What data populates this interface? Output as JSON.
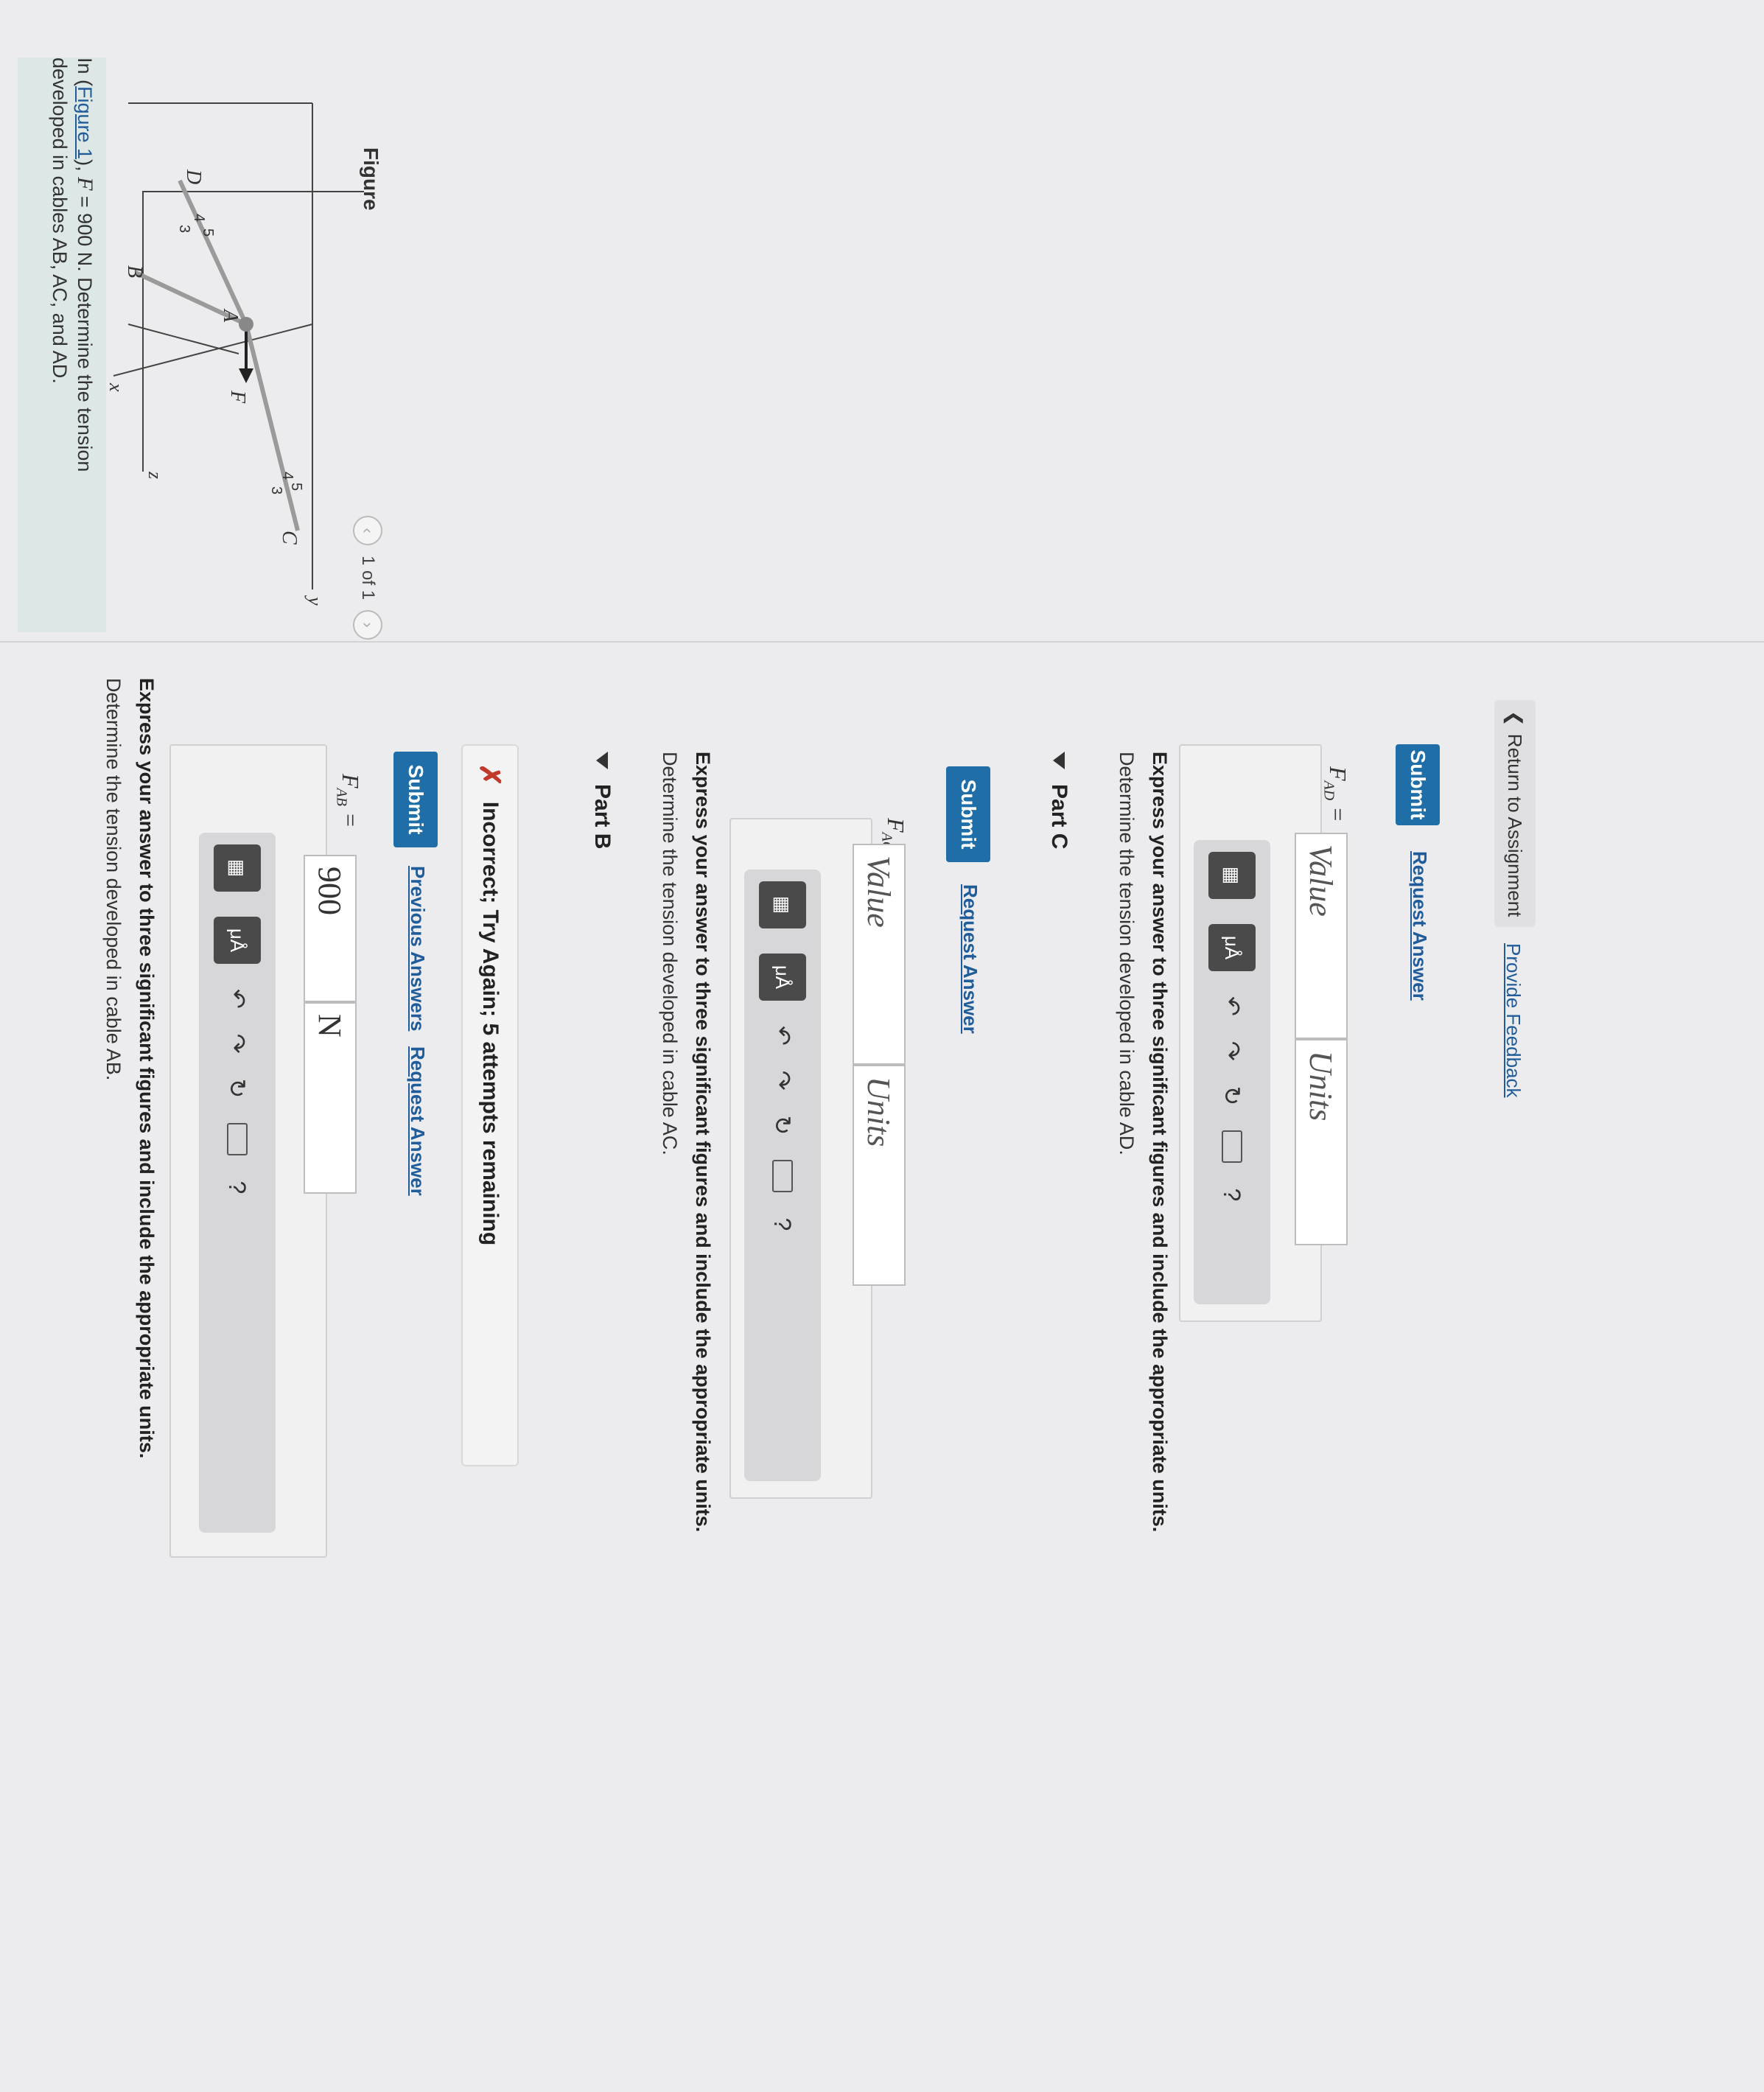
{
  "problem": {
    "prefix": "In (",
    "figure_link": "Figure 1",
    "after_link": "), ",
    "force_var": "F",
    "force_value": " = 900 N. Determine the tension",
    "line2": "developed in cables AB, AC, and AD."
  },
  "figure": {
    "label": "Figure",
    "pager": "1 of 1",
    "prev_icon": "chevron-left",
    "next_icon": "chevron-right",
    "points": {
      "D": "D",
      "B": "B",
      "A": "A",
      "C": "C",
      "F": "F",
      "x": "x",
      "y": "y",
      "z": "z"
    },
    "ratios": {
      "d_4": "4",
      "d_3": "3",
      "d_5": "5",
      "c_4": "4",
      "c_3": "3",
      "c_5": "5"
    }
  },
  "part_a": {
    "prompt": "Determine the tension developed in cable AB.",
    "instruction": "Express your answer to three significant figures and include the appropriate units.",
    "label": "F",
    "label_sub": "AB",
    "equals": " =",
    "value": "900",
    "units": "N",
    "submit": "Submit",
    "previous_answers": "Previous Answers",
    "request_answer": "Request Answer",
    "feedback": "Incorrect; Try Again; 5 attempts remaining"
  },
  "part_b": {
    "title": "Part B",
    "prompt": "Determine the tension developed in cable AC.",
    "instruction": "Express your answer to three significant figures and include the appropriate units.",
    "label": "F",
    "label_sub": "AC",
    "equals": " =",
    "value_placeholder": "Value",
    "units_placeholder": "Units",
    "submit": "Submit",
    "request_answer": "Request Answer"
  },
  "part_c": {
    "title": "Part C",
    "prompt": "Determine the tension developed in cable AD.",
    "instruction": "Express your answer to three significant figures and include the appropriate units.",
    "label": "F",
    "label_sub": "AD",
    "equals": " =",
    "value_placeholder": "Value",
    "units_placeholder": "Units",
    "submit": "Submit",
    "request_answer": "Request Answer"
  },
  "toolbar": {
    "templates_icon": "templates-icon",
    "units_glyph": "μÅ",
    "undo_icon": "undo-icon",
    "redo_icon": "redo-icon",
    "reset_icon": "reset-icon",
    "keyboard_icon": "keyboard-icon",
    "help": "?"
  },
  "footer": {
    "return": "Return to Assignment",
    "feedback": "Provide Feedback"
  }
}
